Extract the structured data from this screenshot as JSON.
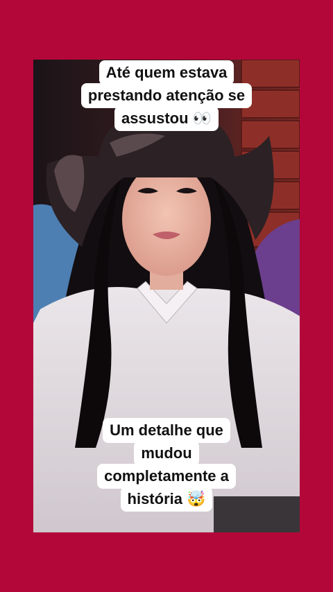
{
  "caption_top": {
    "line1": "Até quem estava",
    "line2": "prestando atenção se",
    "line3": "assustou 👀"
  },
  "caption_bottom": {
    "line1": "Um detalhe que",
    "line2": "mudou",
    "line3": "completamente a",
    "line4": "história 🤯"
  },
  "colors": {
    "background": "#b3073a",
    "caption_bg": "#ffffff",
    "caption_text": "#111111"
  }
}
